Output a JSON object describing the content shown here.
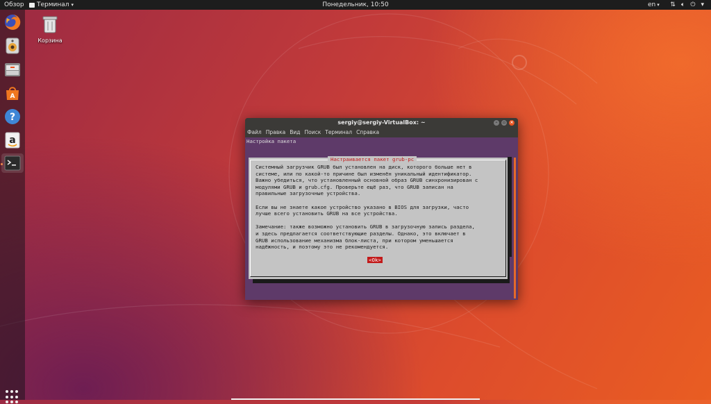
{
  "topbar": {
    "activities": "Обзор",
    "app_menu": "Терминал",
    "clock": "Понедельник, 10:50",
    "lang": "en"
  },
  "dock": {
    "items": [
      {
        "name": "firefox"
      },
      {
        "name": "rhythmbox"
      },
      {
        "name": "files"
      },
      {
        "name": "software-center"
      },
      {
        "name": "help"
      },
      {
        "name": "amazon"
      },
      {
        "name": "terminal"
      }
    ]
  },
  "desktop": {
    "trash_label": "Корзина"
  },
  "terminal": {
    "title": "sergiy@sergiy-VirtualBox: ~",
    "menu": [
      "Файл",
      "Правка",
      "Вид",
      "Поиск",
      "Терминал",
      "Справка"
    ],
    "header": "Настройка пакета",
    "dialog_title": "Настраивается пакет grub-pc",
    "dialog_text": "Системный загрузчик GRUB был установлен на диск, которого больше нет в\nсистеме, или по какой-то причине был изменён уникальный идентификатор.\nВажно убедиться, что установленный основной образ GRUB синхронизирован с\nмодулями GRUB и grub.cfg. Проверьте ещё раз, что GRUB записан на\nправильные загрузочные устройства.\n\nЕсли вы не знаете какое устройство указано в BIOS для загрузки, часто\nлучше всего установить GRUB на все устройства.\n\nЗамечание: также возможно установить GRUB в загрузочную запись раздела,\nи здесь предлагается соответствующие разделы. Однако, это включает в\nGRUB использование механизма блок-листа, при котором уменьшается\nнадёжность, и поэтому это не рекомендуется.",
    "ok_label": "<Ok>"
  },
  "colors": {
    "accent": "#e95420",
    "terminal_bg": "#5e3a69",
    "dialog_bg": "#c4c4c4",
    "ok_bg": "#c21a1a"
  }
}
